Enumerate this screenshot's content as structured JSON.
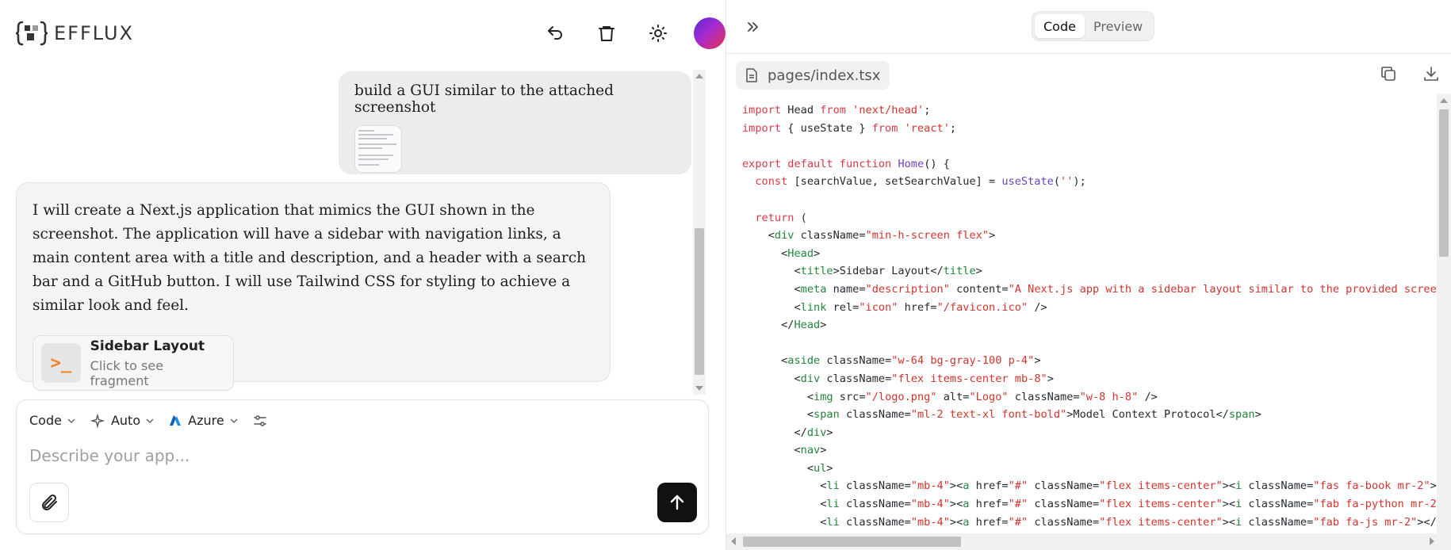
{
  "header": {
    "logo_text": "EFFLUX"
  },
  "chat": {
    "user_message": "build a GUI similar to the attached screenshot",
    "assistant_message": "I will create a Next.js application that mimics the GUI shown in the screenshot. The application will have a sidebar with navigation links, a main content area with a title and description, and a header with a search bar and a GitHub button. I will use Tailwind CSS for styling to achieve a similar look and feel.",
    "fragment": {
      "title": "Sidebar Layout",
      "subtitle": "Click to see fragment",
      "icon": ">_"
    }
  },
  "composer": {
    "mode": "Code",
    "model_select": "Auto",
    "provider": "Azure",
    "placeholder": "Describe your app..."
  },
  "code_panel": {
    "tabs": [
      "Code",
      "Preview"
    ],
    "active_tab": "Code",
    "file_name": "pages/index.tsx"
  },
  "colors": {
    "keyword": "#d73a49",
    "function": "#6f42c1",
    "string": "#d0342c",
    "tag": "#22863a",
    "send_button": "#111111",
    "fragment_icon": "#f58220"
  }
}
